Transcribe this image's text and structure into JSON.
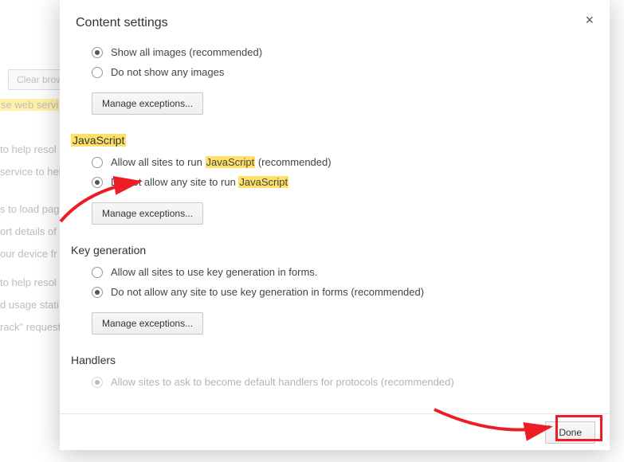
{
  "background": {
    "clear_button": "Clear brow",
    "lines": [
      "se web servi",
      "to help resol",
      "service to hel",
      "s to load pag",
      "ort details of",
      "our device fr",
      "to help resol",
      "d usage stati",
      "rack\" request"
    ]
  },
  "modal": {
    "title": "Content settings",
    "close": "×"
  },
  "images": {
    "option1": "Show all images (recommended)",
    "option2": "Do not show any images",
    "manage": "Manage exceptions..."
  },
  "javascript": {
    "title": "JavaScript",
    "opt1_pre": "Allow all sites to run ",
    "opt1_hl": "JavaScript",
    "opt1_post": " (recommended)",
    "opt2_pre": "Do not allow any site to run ",
    "opt2_hl": "JavaScript",
    "manage": "Manage exceptions..."
  },
  "keygen": {
    "title": "Key generation",
    "option1": "Allow all sites to use key generation in forms.",
    "option2": "Do not allow any site to use key generation in forms (recommended)",
    "manage": "Manage exceptions..."
  },
  "handlers": {
    "title": "Handlers",
    "option1": "Allow sites to ask to become default handlers for protocols (recommended)"
  },
  "footer": {
    "done": "Done"
  }
}
